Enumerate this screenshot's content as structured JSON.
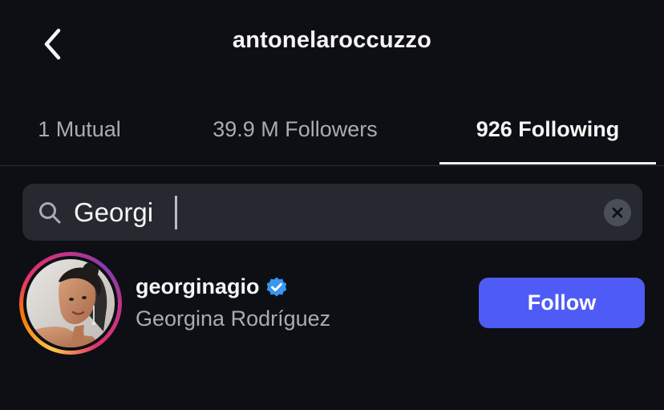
{
  "header": {
    "title": "antonelaroccuzzo",
    "back_icon": "chevron-left-icon"
  },
  "tabs": [
    {
      "label": "1 Mutual",
      "active": false
    },
    {
      "label": "39.9 M Followers",
      "active": false
    },
    {
      "label": "926 Following",
      "active": true
    }
  ],
  "search": {
    "icon": "search-icon",
    "value": "Georgi",
    "clear_icon": "close-icon"
  },
  "results": [
    {
      "username": "georginagio",
      "verified": true,
      "full_name": "Georgina Rodríguez",
      "action_label": "Follow"
    }
  ],
  "colors": {
    "background": "#0d0f14",
    "accent_button": "#4f5bf5",
    "verified_badge": "#3897f0",
    "search_bg": "#26292f"
  }
}
